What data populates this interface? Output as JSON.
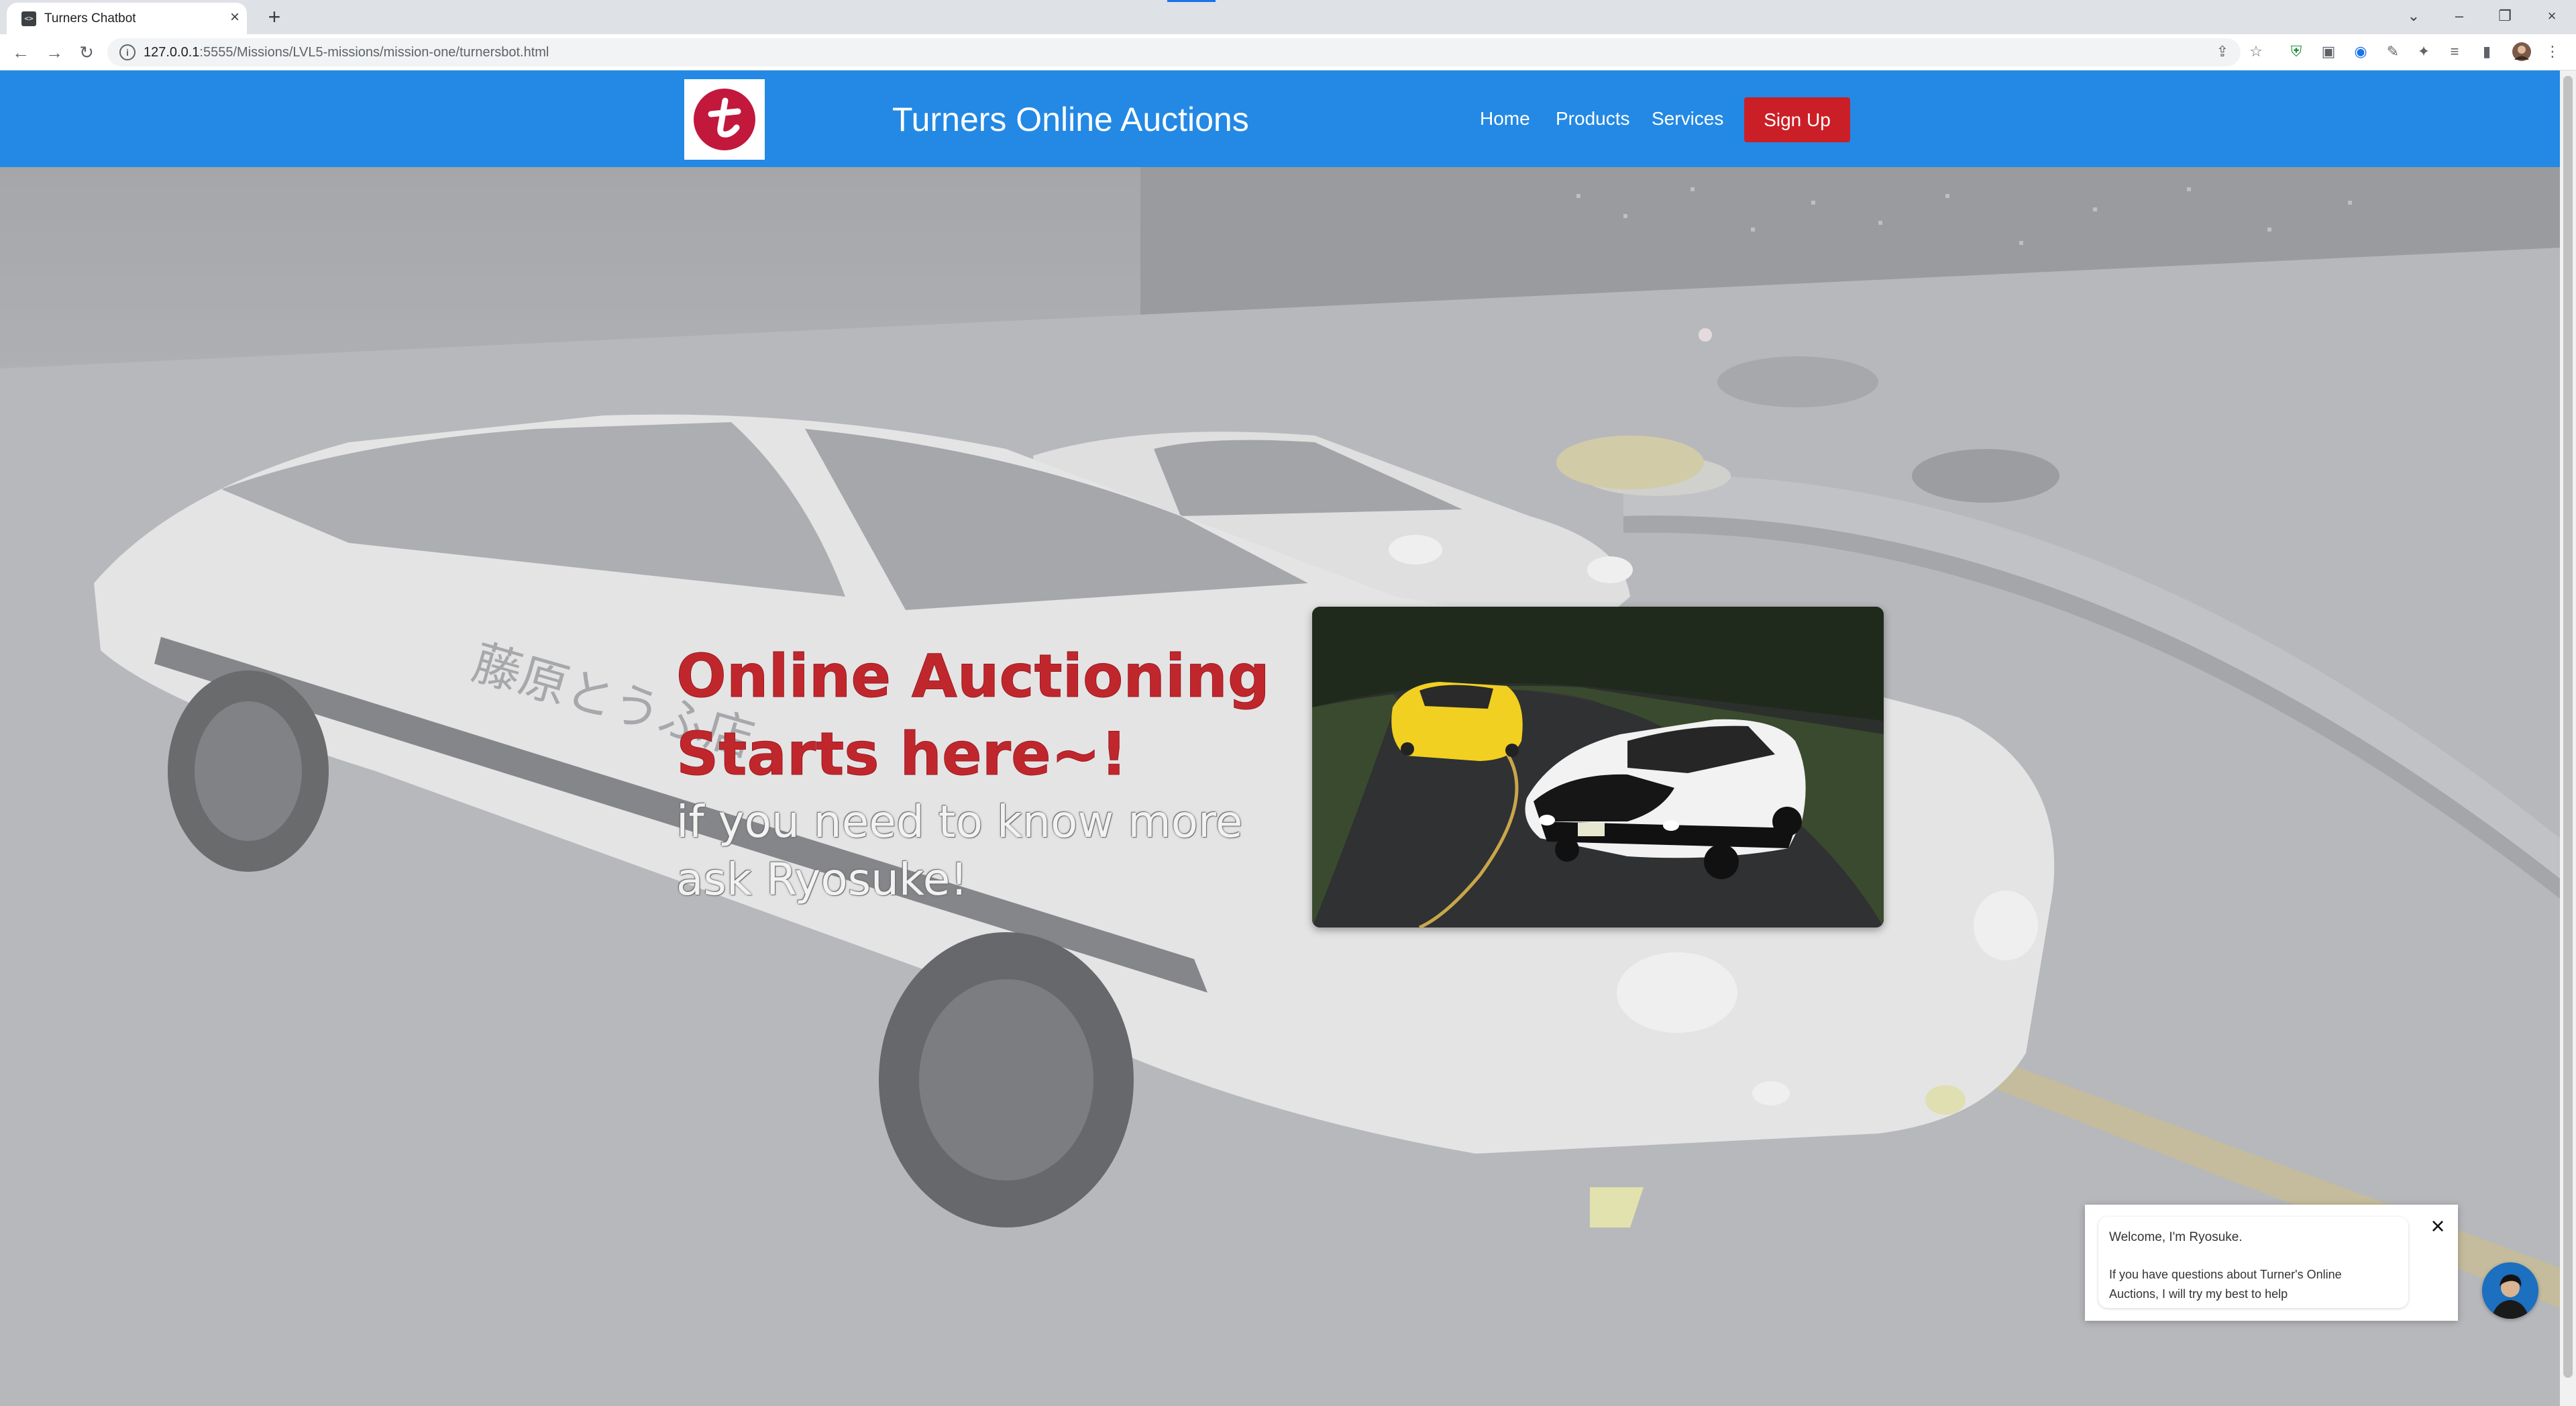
{
  "browser": {
    "tab_title": "Turners Chatbot",
    "tab_favicon": "code-icon",
    "new_tab_label": "+",
    "url_host": "127.0.0.1",
    "url_rest": ":5555/Missions/LVL5-missions/mission-one/turnersbot.html",
    "accent": "#1a73e8"
  },
  "site": {
    "brand": "Turners Online Auctions",
    "logo_letter": "t",
    "logo_color": "#c2183c",
    "navbar_color": "#2389e4",
    "nav": {
      "home": "Home",
      "products": "Products",
      "services": "Services"
    },
    "signup": "Sign Up",
    "signup_color": "#cb1f27"
  },
  "hero": {
    "line1": "Online Auctioning",
    "line2": "Starts here~!",
    "line3": "if you need to know more",
    "line4": "ask Ryosuke!",
    "headline_color": "#c0272d"
  },
  "chat": {
    "greeting": "Welcome, I'm Ryosuke.",
    "message": "If you have questions about Turner's Online Auctions, I will try my best to help"
  }
}
